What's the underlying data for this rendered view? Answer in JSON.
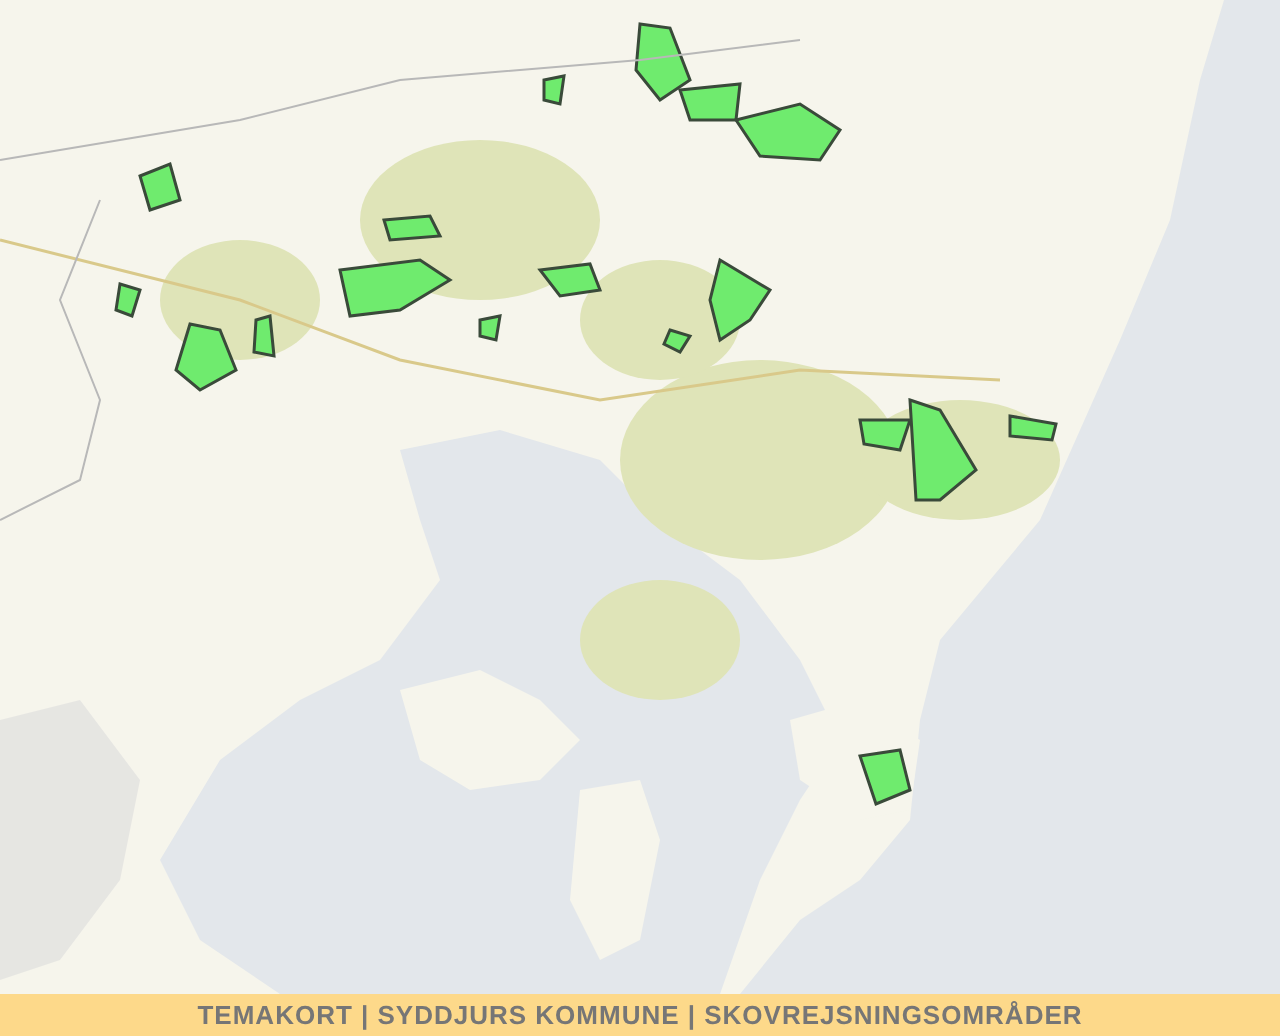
{
  "footer": {
    "title": "TEMAKORT | SYDDJURS KOMMUNE | SKOVREJSNINGSOMRÅDER"
  }
}
